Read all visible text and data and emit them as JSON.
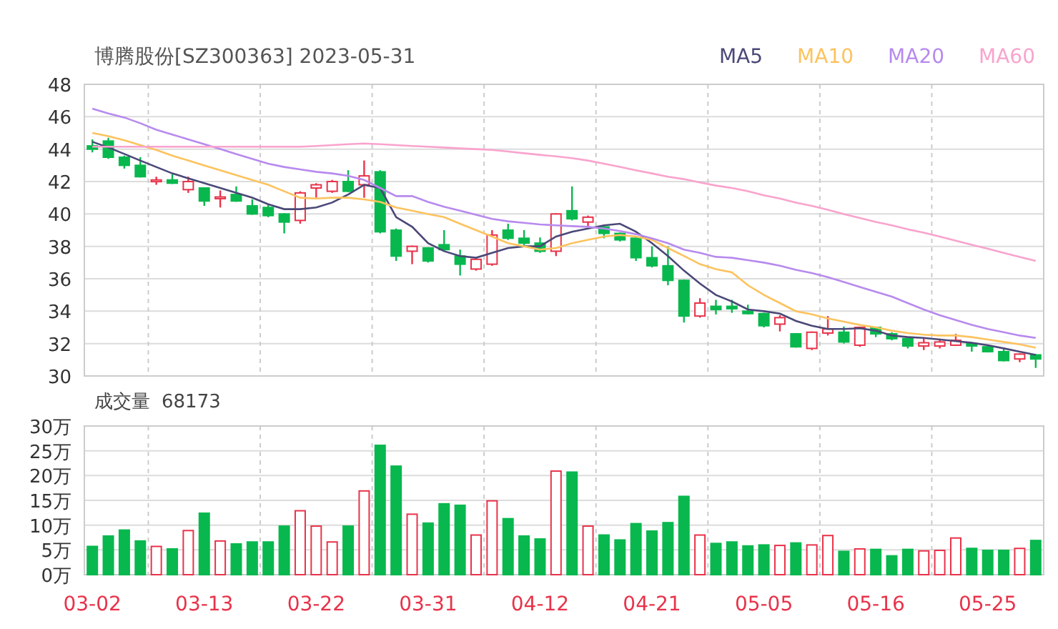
{
  "title": "博腾股份[SZ300363] 2023-05-31",
  "price": {
    "moving_averages": {
      "chart_data": {
        "type": "line",
        "ylim": [
          30,
          48
        ],
        "series": [
          {
            "name": "MA5",
            "color": "#4a4877",
            "values": [
              44.45,
              44.1,
              43.7,
              43.3,
              42.9,
              42.5,
              42.2,
              41.9,
              41.6,
              41.3,
              41.0,
              40.6,
              40.3,
              40.3,
              40.4,
              40.7,
              41.2,
              41.8,
              41.6,
              39.8,
              39.2,
              38.2,
              37.7,
              37.4,
              37.3,
              37.6,
              37.9,
              38.0,
              38.0,
              38.6,
              38.9,
              39.1,
              39.3,
              39.4,
              38.9,
              38.2,
              37.4,
              36.5,
              35.7,
              35.0,
              34.6,
              34.1,
              34.0,
              33.85,
              33.4,
              33.1,
              32.9,
              32.9,
              32.95,
              32.8,
              32.5,
              32.4,
              32.35,
              32.25,
              32.15,
              32.05,
              31.9,
              31.7,
              31.5,
              31.3
            ]
          },
          {
            "name": "MA10",
            "color": "#fcc35e",
            "values": [
              45.0,
              44.8,
              44.55,
              44.25,
              43.95,
              43.6,
              43.3,
              43.0,
              42.7,
              42.4,
              42.1,
              41.8,
              41.4,
              41.0,
              40.95,
              41.0,
              41.0,
              40.9,
              40.75,
              40.4,
              40.2,
              40.0,
              39.8,
              39.4,
              39.0,
              38.6,
              38.2,
              38.0,
              37.8,
              37.9,
              38.2,
              38.4,
              38.6,
              38.7,
              38.6,
              38.4,
              37.9,
              37.4,
              36.9,
              36.6,
              36.4,
              35.6,
              35.0,
              34.5,
              34.0,
              33.8,
              33.55,
              33.35,
              33.15,
              33.0,
              32.8,
              32.65,
              32.55,
              32.5,
              32.5,
              32.4,
              32.25,
              32.1,
              31.95,
              31.75
            ]
          },
          {
            "name": "MA20",
            "color": "#b78aee",
            "values": [
              46.5,
              46.2,
              45.95,
              45.6,
              45.2,
              44.9,
              44.6,
              44.3,
              44.0,
              43.7,
              43.4,
              43.1,
              42.9,
              42.75,
              42.6,
              42.5,
              42.35,
              42.1,
              41.6,
              41.1,
              41.1,
              40.75,
              40.45,
              40.2,
              39.95,
              39.7,
              39.55,
              39.45,
              39.35,
              39.3,
              39.25,
              39.2,
              39.1,
              38.95,
              38.75,
              38.5,
              38.2,
              37.8,
              37.6,
              37.35,
              37.3,
              37.15,
              37.0,
              36.8,
              36.55,
              36.35,
              36.1,
              35.8,
              35.5,
              35.2,
              34.9,
              34.5,
              34.1,
              33.75,
              33.45,
              33.15,
              32.9,
              32.7,
              32.5,
              32.35
            ]
          },
          {
            "name": "MA60",
            "color": "#f9a3cd",
            "values": [
              44.15,
              44.15,
              44.15,
              44.15,
              44.15,
              44.15,
              44.15,
              44.15,
              44.15,
              44.15,
              44.15,
              44.15,
              44.15,
              44.15,
              44.2,
              44.25,
              44.3,
              44.35,
              44.3,
              44.25,
              44.2,
              44.15,
              44.1,
              44.05,
              44.0,
              43.95,
              43.85,
              43.75,
              43.65,
              43.55,
              43.45,
              43.3,
              43.1,
              42.9,
              42.7,
              42.5,
              42.3,
              42.15,
              41.95,
              41.75,
              41.6,
              41.4,
              41.15,
              40.95,
              40.7,
              40.5,
              40.25,
              40.0,
              39.75,
              39.5,
              39.3,
              39.05,
              38.85,
              38.6,
              38.35,
              38.1,
              37.85,
              37.6,
              37.35,
              37.1
            ]
          }
        ]
      }
    },
    "candles": {
      "chart_data": {
        "type": "candlestick",
        "grid": true,
        "ylim": [
          30,
          48
        ],
        "yticks": [
          30,
          32,
          34,
          36,
          38,
          40,
          42,
          44,
          46,
          48
        ],
        "ohlc": [
          [
            44.2,
            44.6,
            43.8,
            44.0
          ],
          [
            44.5,
            44.7,
            43.4,
            43.5
          ],
          [
            43.5,
            43.6,
            42.8,
            43.0
          ],
          [
            43.0,
            43.5,
            42.25,
            42.3
          ],
          [
            42.0,
            42.3,
            41.8,
            42.1
          ],
          [
            42.1,
            42.45,
            41.85,
            41.9
          ],
          [
            41.5,
            42.3,
            41.3,
            42.0
          ],
          [
            41.6,
            41.65,
            40.5,
            40.8
          ],
          [
            40.95,
            41.45,
            40.4,
            41.05
          ],
          [
            41.2,
            41.7,
            40.75,
            40.8
          ],
          [
            40.5,
            40.9,
            39.95,
            40.0
          ],
          [
            40.4,
            40.6,
            39.8,
            39.9
          ],
          [
            40.0,
            40.05,
            38.8,
            39.5
          ],
          [
            39.6,
            41.4,
            39.4,
            41.3
          ],
          [
            41.6,
            41.9,
            41.0,
            41.8
          ],
          [
            41.4,
            42.1,
            41.3,
            42.0
          ],
          [
            42.0,
            42.7,
            41.35,
            41.4
          ],
          [
            41.8,
            43.3,
            41.0,
            42.35
          ],
          [
            42.6,
            42.7,
            38.8,
            38.9
          ],
          [
            39.0,
            39.1,
            37.1,
            37.4
          ],
          [
            37.7,
            38.05,
            36.9,
            38.0
          ],
          [
            37.9,
            37.95,
            37.0,
            37.1
          ],
          [
            38.1,
            39.0,
            37.7,
            37.8
          ],
          [
            37.4,
            37.8,
            36.2,
            36.9
          ],
          [
            36.6,
            37.3,
            36.5,
            37.2
          ],
          [
            36.9,
            39.0,
            36.8,
            38.7
          ],
          [
            39.0,
            39.4,
            38.4,
            38.5
          ],
          [
            38.5,
            39.0,
            37.95,
            38.2
          ],
          [
            38.2,
            38.55,
            37.6,
            37.7
          ],
          [
            37.7,
            40.05,
            37.4,
            40.0
          ],
          [
            40.2,
            41.7,
            39.6,
            39.7
          ],
          [
            39.5,
            39.9,
            39.2,
            39.8
          ],
          [
            39.2,
            39.3,
            38.5,
            38.8
          ],
          [
            38.8,
            38.85,
            38.3,
            38.4
          ],
          [
            38.5,
            38.55,
            37.1,
            37.3
          ],
          [
            37.3,
            38.0,
            36.7,
            36.8
          ],
          [
            36.8,
            38.0,
            35.6,
            35.9
          ],
          [
            35.9,
            35.95,
            33.3,
            33.7
          ],
          [
            33.7,
            34.8,
            33.6,
            34.5
          ],
          [
            34.3,
            34.7,
            33.8,
            34.1
          ],
          [
            34.3,
            34.7,
            33.9,
            34.15
          ],
          [
            34.0,
            34.4,
            33.8,
            33.85
          ],
          [
            33.85,
            33.9,
            33.0,
            33.1
          ],
          [
            33.2,
            33.75,
            32.75,
            33.6
          ],
          [
            32.6,
            32.65,
            31.75,
            31.8
          ],
          [
            31.7,
            32.75,
            31.6,
            32.7
          ],
          [
            32.65,
            33.7,
            32.5,
            32.9
          ],
          [
            32.7,
            33.05,
            32.0,
            32.1
          ],
          [
            31.9,
            33.05,
            31.8,
            33.0
          ],
          [
            33.0,
            33.05,
            32.4,
            32.6
          ],
          [
            32.6,
            32.7,
            32.2,
            32.3
          ],
          [
            32.3,
            32.35,
            31.7,
            31.85
          ],
          [
            31.85,
            32.3,
            31.6,
            32.05
          ],
          [
            31.85,
            32.3,
            31.7,
            32.1
          ],
          [
            31.9,
            32.6,
            31.85,
            32.2
          ],
          [
            32.0,
            32.05,
            31.5,
            31.85
          ],
          [
            31.8,
            31.9,
            31.45,
            31.5
          ],
          [
            31.5,
            31.65,
            30.9,
            30.95
          ],
          [
            31.05,
            31.4,
            30.85,
            31.35
          ],
          [
            31.3,
            31.35,
            30.5,
            31.05
          ]
        ]
      }
    }
  },
  "volume": {
    "label": "成交量",
    "value": "68173",
    "chart_data": {
      "type": "bar",
      "grid": true,
      "categories": [
        "03-02",
        null,
        null,
        null,
        null,
        null,
        null,
        "03-13",
        null,
        null,
        null,
        null,
        null,
        null,
        "03-22",
        null,
        null,
        null,
        null,
        null,
        null,
        "03-31",
        null,
        null,
        null,
        null,
        null,
        null,
        "04-12",
        null,
        null,
        null,
        null,
        null,
        null,
        "04-21",
        null,
        null,
        null,
        null,
        null,
        null,
        "05-05",
        null,
        null,
        null,
        null,
        null,
        null,
        "05-16",
        null,
        null,
        null,
        null,
        null,
        null,
        "05-25",
        null,
        null,
        null
      ],
      "ylim": [
        0,
        30
      ],
      "yticks": [
        {
          "value": 0,
          "label": "0万"
        },
        {
          "value": 5,
          "label": "5万"
        },
        {
          "value": 10,
          "label": "10万"
        },
        {
          "value": 15,
          "label": "15万"
        },
        {
          "value": 20,
          "label": "20万"
        },
        {
          "value": 25,
          "label": "25万"
        },
        {
          "value": 30,
          "label": "30万"
        }
      ],
      "values": [
        5.7,
        7.8,
        9.0,
        6.8,
        5.7,
        5.2,
        8.9,
        12.4,
        6.8,
        6.2,
        6.6,
        6.6,
        9.8,
        12.9,
        9.8,
        6.6,
        9.8,
        16.9,
        26.1,
        21.9,
        12.2,
        10.4,
        14.3,
        14.0,
        8.0,
        14.9,
        11.3,
        7.8,
        7.2,
        20.9,
        20.7,
        9.8,
        8.0,
        7.0,
        10.3,
        8.8,
        10.5,
        15.8,
        8.0,
        6.3,
        6.6,
        5.8,
        6.0,
        5.9,
        6.4,
        6.0,
        7.9,
        4.7,
        5.2,
        5.1,
        3.8,
        5.1,
        4.8,
        4.9,
        7.4,
        5.3,
        4.9,
        4.9,
        5.3,
        6.9
      ]
    }
  }
}
